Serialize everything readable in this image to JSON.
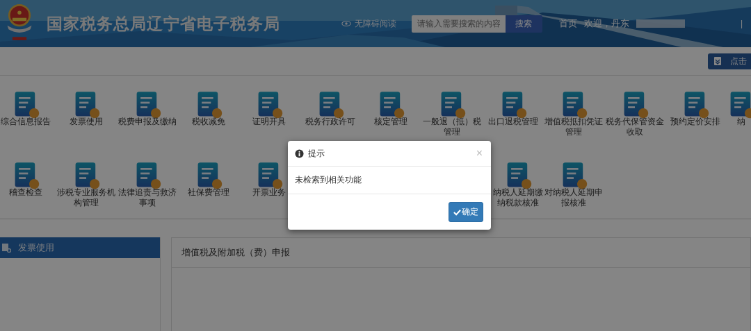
{
  "header": {
    "title": "国家税务总局辽宁省电子税务局",
    "accessibility_link": "无障碍阅读",
    "search": {
      "placeholder": "请输入需要搜索的内容",
      "button": "搜索"
    },
    "home_link": "首页",
    "welcome": "欢迎，丹东",
    "separator": "|"
  },
  "toolbar": {
    "button": "点击"
  },
  "services": [
    {
      "items": [
        {
          "label": "综合信息报告"
        },
        {
          "label": "发票使用"
        },
        {
          "label": "税费申报及缴纳"
        },
        {
          "label": "税收减免"
        },
        {
          "label": "证明开具"
        },
        {
          "label": "税务行政许可"
        },
        {
          "label": "核定管理"
        },
        {
          "label": "一般退（抵）税管理"
        },
        {
          "label": "出口退税管理"
        },
        {
          "label": "增值税抵扣凭证管理"
        },
        {
          "label": "税务代保管资金收取"
        },
        {
          "label": "预约定价安排"
        },
        {
          "label": "纳"
        }
      ]
    },
    {
      "items": [
        {
          "label": "稽查检查"
        },
        {
          "label": "涉税专业服务机构管理"
        },
        {
          "label": "法律追责与救济事项"
        },
        {
          "label": "社保费管理"
        },
        {
          "label": "开票业务"
        },
        {
          "label": "纳税人延期缴纳税款核准"
        },
        {
          "label": "对纳税人延期申报核准"
        }
      ]
    }
  ],
  "sidebar": {
    "items": [
      {
        "label": "发票使用",
        "selected": true
      }
    ]
  },
  "panel": {
    "title": "增值税及附加税（费）申报"
  },
  "dialog": {
    "title": "提示",
    "close": "×",
    "message": "未检索到相关功能",
    "button": "确定"
  }
}
